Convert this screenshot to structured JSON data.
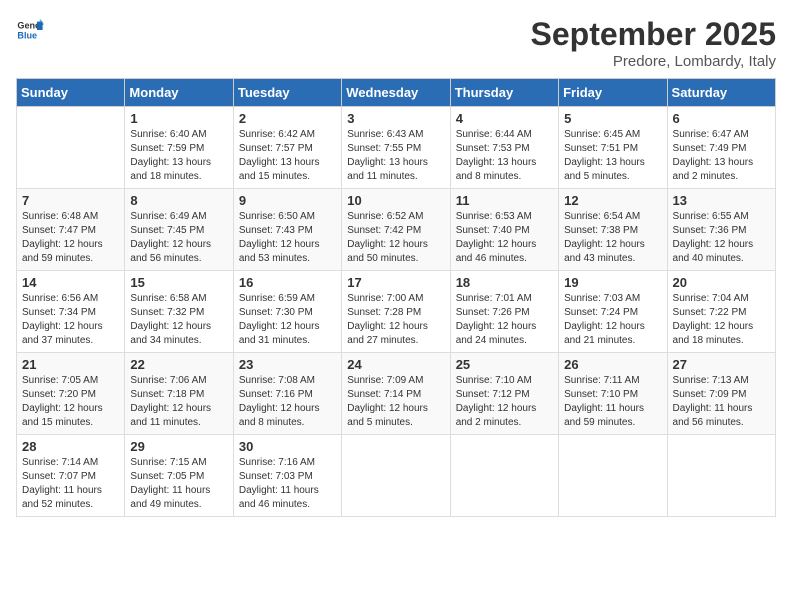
{
  "header": {
    "logo_line1": "General",
    "logo_line2": "Blue",
    "month": "September 2025",
    "location": "Predore, Lombardy, Italy"
  },
  "weekdays": [
    "Sunday",
    "Monday",
    "Tuesday",
    "Wednesday",
    "Thursday",
    "Friday",
    "Saturday"
  ],
  "weeks": [
    [
      {
        "day": "",
        "sunrise": "",
        "sunset": "",
        "daylight": ""
      },
      {
        "day": "1",
        "sunrise": "Sunrise: 6:40 AM",
        "sunset": "Sunset: 7:59 PM",
        "daylight": "Daylight: 13 hours and 18 minutes."
      },
      {
        "day": "2",
        "sunrise": "Sunrise: 6:42 AM",
        "sunset": "Sunset: 7:57 PM",
        "daylight": "Daylight: 13 hours and 15 minutes."
      },
      {
        "day": "3",
        "sunrise": "Sunrise: 6:43 AM",
        "sunset": "Sunset: 7:55 PM",
        "daylight": "Daylight: 13 hours and 11 minutes."
      },
      {
        "day": "4",
        "sunrise": "Sunrise: 6:44 AM",
        "sunset": "Sunset: 7:53 PM",
        "daylight": "Daylight: 13 hours and 8 minutes."
      },
      {
        "day": "5",
        "sunrise": "Sunrise: 6:45 AM",
        "sunset": "Sunset: 7:51 PM",
        "daylight": "Daylight: 13 hours and 5 minutes."
      },
      {
        "day": "6",
        "sunrise": "Sunrise: 6:47 AM",
        "sunset": "Sunset: 7:49 PM",
        "daylight": "Daylight: 13 hours and 2 minutes."
      }
    ],
    [
      {
        "day": "7",
        "sunrise": "Sunrise: 6:48 AM",
        "sunset": "Sunset: 7:47 PM",
        "daylight": "Daylight: 12 hours and 59 minutes."
      },
      {
        "day": "8",
        "sunrise": "Sunrise: 6:49 AM",
        "sunset": "Sunset: 7:45 PM",
        "daylight": "Daylight: 12 hours and 56 minutes."
      },
      {
        "day": "9",
        "sunrise": "Sunrise: 6:50 AM",
        "sunset": "Sunset: 7:43 PM",
        "daylight": "Daylight: 12 hours and 53 minutes."
      },
      {
        "day": "10",
        "sunrise": "Sunrise: 6:52 AM",
        "sunset": "Sunset: 7:42 PM",
        "daylight": "Daylight: 12 hours and 50 minutes."
      },
      {
        "day": "11",
        "sunrise": "Sunrise: 6:53 AM",
        "sunset": "Sunset: 7:40 PM",
        "daylight": "Daylight: 12 hours and 46 minutes."
      },
      {
        "day": "12",
        "sunrise": "Sunrise: 6:54 AM",
        "sunset": "Sunset: 7:38 PM",
        "daylight": "Daylight: 12 hours and 43 minutes."
      },
      {
        "day": "13",
        "sunrise": "Sunrise: 6:55 AM",
        "sunset": "Sunset: 7:36 PM",
        "daylight": "Daylight: 12 hours and 40 minutes."
      }
    ],
    [
      {
        "day": "14",
        "sunrise": "Sunrise: 6:56 AM",
        "sunset": "Sunset: 7:34 PM",
        "daylight": "Daylight: 12 hours and 37 minutes."
      },
      {
        "day": "15",
        "sunrise": "Sunrise: 6:58 AM",
        "sunset": "Sunset: 7:32 PM",
        "daylight": "Daylight: 12 hours and 34 minutes."
      },
      {
        "day": "16",
        "sunrise": "Sunrise: 6:59 AM",
        "sunset": "Sunset: 7:30 PM",
        "daylight": "Daylight: 12 hours and 31 minutes."
      },
      {
        "day": "17",
        "sunrise": "Sunrise: 7:00 AM",
        "sunset": "Sunset: 7:28 PM",
        "daylight": "Daylight: 12 hours and 27 minutes."
      },
      {
        "day": "18",
        "sunrise": "Sunrise: 7:01 AM",
        "sunset": "Sunset: 7:26 PM",
        "daylight": "Daylight: 12 hours and 24 minutes."
      },
      {
        "day": "19",
        "sunrise": "Sunrise: 7:03 AM",
        "sunset": "Sunset: 7:24 PM",
        "daylight": "Daylight: 12 hours and 21 minutes."
      },
      {
        "day": "20",
        "sunrise": "Sunrise: 7:04 AM",
        "sunset": "Sunset: 7:22 PM",
        "daylight": "Daylight: 12 hours and 18 minutes."
      }
    ],
    [
      {
        "day": "21",
        "sunrise": "Sunrise: 7:05 AM",
        "sunset": "Sunset: 7:20 PM",
        "daylight": "Daylight: 12 hours and 15 minutes."
      },
      {
        "day": "22",
        "sunrise": "Sunrise: 7:06 AM",
        "sunset": "Sunset: 7:18 PM",
        "daylight": "Daylight: 12 hours and 11 minutes."
      },
      {
        "day": "23",
        "sunrise": "Sunrise: 7:08 AM",
        "sunset": "Sunset: 7:16 PM",
        "daylight": "Daylight: 12 hours and 8 minutes."
      },
      {
        "day": "24",
        "sunrise": "Sunrise: 7:09 AM",
        "sunset": "Sunset: 7:14 PM",
        "daylight": "Daylight: 12 hours and 5 minutes."
      },
      {
        "day": "25",
        "sunrise": "Sunrise: 7:10 AM",
        "sunset": "Sunset: 7:12 PM",
        "daylight": "Daylight: 12 hours and 2 minutes."
      },
      {
        "day": "26",
        "sunrise": "Sunrise: 7:11 AM",
        "sunset": "Sunset: 7:10 PM",
        "daylight": "Daylight: 11 hours and 59 minutes."
      },
      {
        "day": "27",
        "sunrise": "Sunrise: 7:13 AM",
        "sunset": "Sunset: 7:09 PM",
        "daylight": "Daylight: 11 hours and 56 minutes."
      }
    ],
    [
      {
        "day": "28",
        "sunrise": "Sunrise: 7:14 AM",
        "sunset": "Sunset: 7:07 PM",
        "daylight": "Daylight: 11 hours and 52 minutes."
      },
      {
        "day": "29",
        "sunrise": "Sunrise: 7:15 AM",
        "sunset": "Sunset: 7:05 PM",
        "daylight": "Daylight: 11 hours and 49 minutes."
      },
      {
        "day": "30",
        "sunrise": "Sunrise: 7:16 AM",
        "sunset": "Sunset: 7:03 PM",
        "daylight": "Daylight: 11 hours and 46 minutes."
      },
      {
        "day": "",
        "sunrise": "",
        "sunset": "",
        "daylight": ""
      },
      {
        "day": "",
        "sunrise": "",
        "sunset": "",
        "daylight": ""
      },
      {
        "day": "",
        "sunrise": "",
        "sunset": "",
        "daylight": ""
      },
      {
        "day": "",
        "sunrise": "",
        "sunset": "",
        "daylight": ""
      }
    ]
  ]
}
